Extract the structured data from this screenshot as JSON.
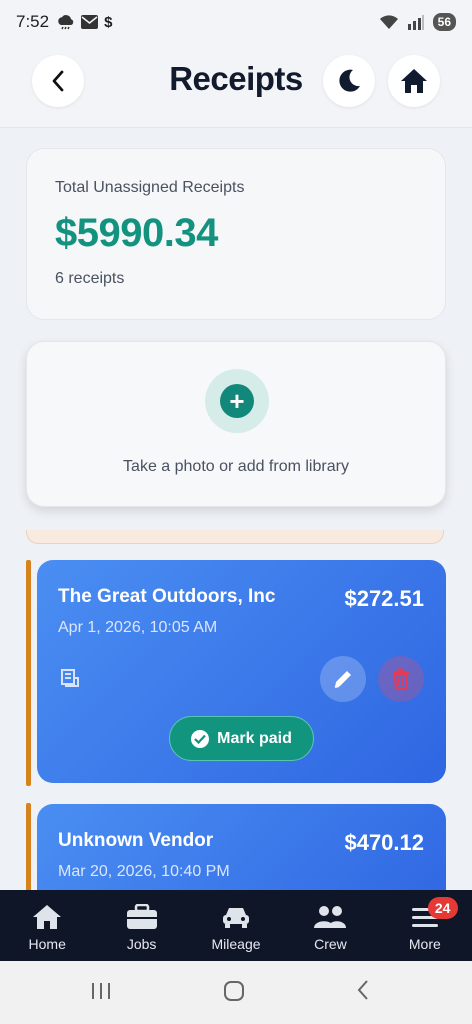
{
  "status_bar": {
    "time": "7:52",
    "dollar": "$",
    "battery": "56"
  },
  "header": {
    "title": "Receipts"
  },
  "summary": {
    "label": "Total Unassigned Receipts",
    "total": "$5990.34",
    "count": "6 receipts"
  },
  "add_receipt": {
    "plus": "+",
    "text": "Take a photo or add from library"
  },
  "receipts": [
    {
      "vendor": "The Great Outdoors, Inc",
      "amount": "$272.51",
      "datetime": "Apr 1, 2026, 10:05 AM",
      "mark_paid_label": "Mark paid"
    },
    {
      "vendor": "Unknown Vendor",
      "amount": "$470.12",
      "datetime": "Mar 20, 2026, 10:40 PM"
    }
  ],
  "bottom_nav": {
    "items": [
      {
        "label": "Home",
        "icon": "home-icon"
      },
      {
        "label": "Jobs",
        "icon": "briefcase-icon"
      },
      {
        "label": "Mileage",
        "icon": "car-icon"
      },
      {
        "label": "Crew",
        "icon": "people-icon"
      },
      {
        "label": "More",
        "icon": "menu-icon"
      }
    ],
    "more_badge": "24"
  },
  "colors": {
    "accent_green": "#13937f",
    "card_blue": "#3a78ea",
    "nav_bg": "#0f1627",
    "badge_red": "#e53935",
    "accent_orange": "#d6831e"
  }
}
